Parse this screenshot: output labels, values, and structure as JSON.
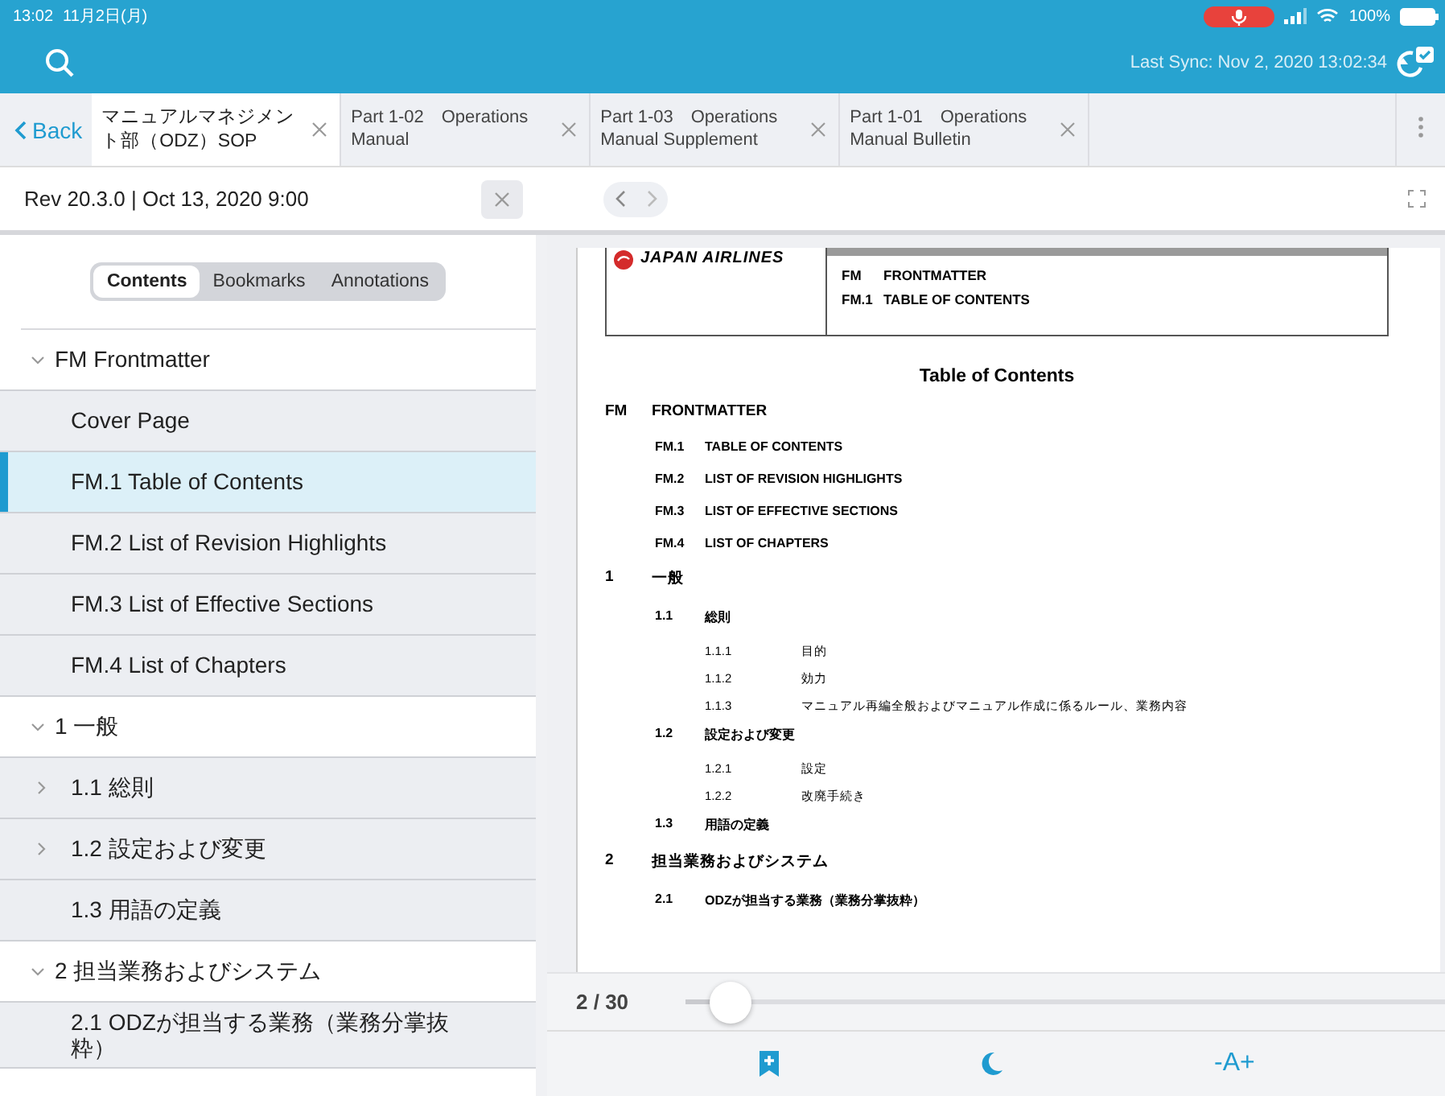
{
  "status_bar": {
    "time": "13:02",
    "date": "11月2日(月)",
    "battery": "100%"
  },
  "top_bar": {
    "last_sync": "Last Sync: Nov 2, 2020 13:02:34"
  },
  "back": "Back",
  "tabs": [
    {
      "label": "マニュアルマネジメント部（ODZ）SOP",
      "selected": true
    },
    {
      "label": "Part 1-02　Operations Manual",
      "selected": false
    },
    {
      "label": "Part 1-03　Operations Manual Supplement",
      "selected": false
    },
    {
      "label": "Part 1-01　Operations Manual Bulletin",
      "selected": false
    }
  ],
  "revision": "Rev 20.3.0 | Oct 13, 2020 9:00",
  "sidebar": {
    "segments": [
      {
        "label": "Contents",
        "selected": true
      },
      {
        "label": "Bookmarks",
        "selected": false
      },
      {
        "label": "Annotations",
        "selected": false
      }
    ],
    "tree": [
      {
        "label": "FM Frontmatter",
        "expanded": true,
        "children": [
          {
            "label": "Cover Page",
            "selected": false
          },
          {
            "label": "FM.1 Table of Contents",
            "selected": true
          },
          {
            "label": "FM.2 List of Revision Highlights",
            "selected": false
          },
          {
            "label": "FM.3 List of Effective Sections",
            "selected": false
          },
          {
            "label": "FM.4 List of Chapters",
            "selected": false
          }
        ]
      },
      {
        "label": "1 一般",
        "expanded": true,
        "children": [
          {
            "label": "1.1 総則",
            "expanded": false,
            "selected": false
          },
          {
            "label": "1.2 設定および変更",
            "expanded": false,
            "selected": false
          },
          {
            "label": "1.3 用語の定義",
            "selected": false
          }
        ]
      },
      {
        "label": "2 担当業務およびシステム",
        "expanded": true,
        "children": [
          {
            "label": "2.1 ODZが担当する業務（業務分掌抜粋）",
            "selected": false
          }
        ]
      }
    ]
  },
  "document": {
    "brand": "JAPAN AIRLINES",
    "header": [
      {
        "code": "FM",
        "title": "FRONTMATTER"
      },
      {
        "code": "FM.1",
        "title": "TABLE OF CONTENTS"
      }
    ],
    "title": "Table of Contents",
    "toc": [
      {
        "number": "FM",
        "title": "FRONTMATTER",
        "children": [
          {
            "number": "FM.1",
            "title": "TABLE OF CONTENTS"
          },
          {
            "number": "FM.2",
            "title": "LIST OF REVISION HIGHLIGHTS"
          },
          {
            "number": "FM.3",
            "title": "LIST OF EFFECTIVE SECTIONS"
          },
          {
            "number": "FM.4",
            "title": "LIST OF CHAPTERS"
          }
        ]
      },
      {
        "number": "1",
        "title": "一般",
        "children": [
          {
            "number": "1.1",
            "title": "総則",
            "children": [
              {
                "number": "1.1.1",
                "title": "目的"
              },
              {
                "number": "1.1.2",
                "title": "効力"
              },
              {
                "number": "1.1.3",
                "title": "マニュアル再編全般およびマニュアル作成に係るルール、業務内容"
              }
            ]
          },
          {
            "number": "1.2",
            "title": "設定および変更",
            "children": [
              {
                "number": "1.2.1",
                "title": "設定"
              },
              {
                "number": "1.2.2",
                "title": "改廃手続き"
              }
            ]
          },
          {
            "number": "1.3",
            "title": "用語の定義"
          }
        ]
      },
      {
        "number": "2",
        "title": "担当業務およびシステム",
        "children": [
          {
            "number": "2.1",
            "title": "ODZが担当する業務（業務分掌抜粋）"
          }
        ]
      }
    ]
  },
  "pager": {
    "page": "2 / 30",
    "level": 0.06
  },
  "toolbar": {
    "font_size": "-A+"
  }
}
